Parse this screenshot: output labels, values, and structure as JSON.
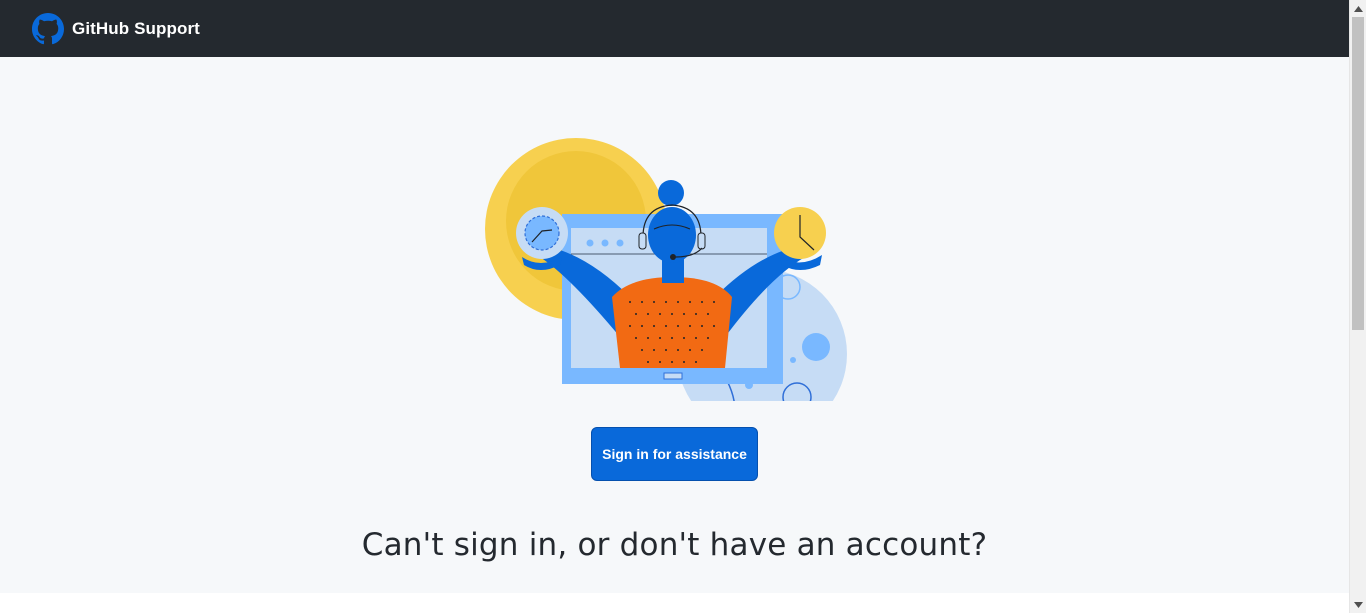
{
  "header": {
    "brand_name": "GitHub Support",
    "logo_icon": "github-octocat-icon",
    "background": "#24292f"
  },
  "hero": {
    "illustration": "support-agent-illustration",
    "signin_label": "Sign in for assistance",
    "heading": "Can't sign in, or don't have an account?"
  },
  "colors": {
    "primary_button": "#0969da",
    "heading_text": "#24292f",
    "page_background": "#f6f8fa",
    "accent_yellow": "#f7d04f",
    "accent_blue": "#0969da",
    "accent_orange": "#f26a13",
    "light_blue": "#c6dcf5"
  }
}
